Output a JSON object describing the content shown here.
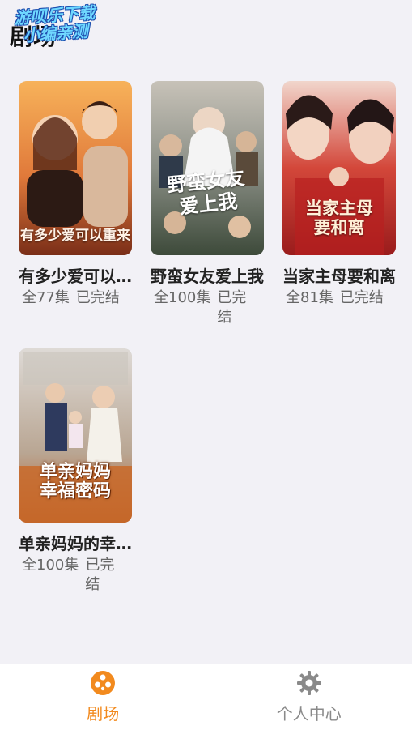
{
  "header": {
    "title": "剧场",
    "watermark_line1": "游呗乐下载",
    "watermark_line2": "小编亲测"
  },
  "dramas": [
    {
      "title": "有多少爱可以重来",
      "episodes": "全77集",
      "status": "已完结",
      "poster_text": "有多少爱可以重来"
    },
    {
      "title": "野蛮女友爱上我",
      "episodes": "全100集",
      "status": "已完结",
      "poster_text_line1": "野蛮女友",
      "poster_text_line2": "爱上我"
    },
    {
      "title": "当家主母要和离",
      "episodes": "全81集",
      "status": "已完结",
      "poster_text_line1": "当家主母",
      "poster_text_line2": "要和离"
    },
    {
      "title": "单亲妈妈的幸福密码",
      "episodes": "全100集",
      "status": "已完结",
      "poster_text_line1": "单亲妈妈",
      "poster_text_line2": "幸福密码"
    }
  ],
  "tabbar": {
    "tabs": [
      {
        "label": "剧场",
        "icon": "film-reel-icon",
        "active": true
      },
      {
        "label": "个人中心",
        "icon": "gear-icon",
        "active": false
      }
    ]
  },
  "colors": {
    "accent": "#f28a1e",
    "inactive": "#8a8a8a",
    "background": "#f2f1f6"
  }
}
